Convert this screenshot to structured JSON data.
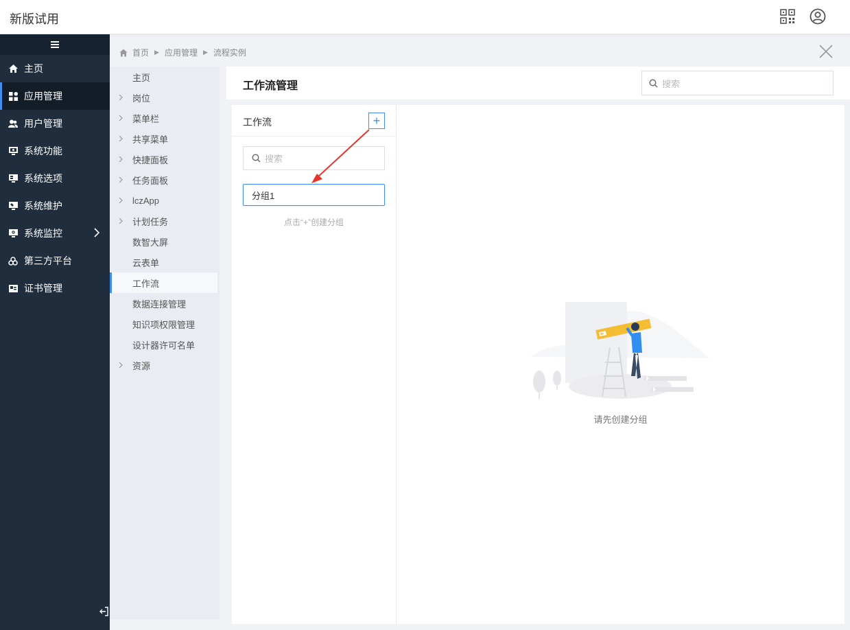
{
  "header": {
    "title": "新版试用",
    "icons": [
      "qr-code-icon",
      "user-circle-icon"
    ]
  },
  "sidenav": {
    "items": [
      {
        "label": "主页",
        "icon": "home-icon"
      },
      {
        "label": "应用管理",
        "icon": "apps-icon",
        "active": true
      },
      {
        "label": "用户管理",
        "icon": "users-icon"
      },
      {
        "label": "系统功能",
        "icon": "system-function-icon"
      },
      {
        "label": "系统选项",
        "icon": "system-options-icon"
      },
      {
        "label": "系统维护",
        "icon": "maintenance-icon"
      },
      {
        "label": "系统监控",
        "icon": "monitor-icon",
        "has_children": true
      },
      {
        "label": "第三方平台",
        "icon": "third-party-icon"
      },
      {
        "label": "证书管理",
        "icon": "certificate-icon"
      }
    ]
  },
  "submenu": {
    "items": [
      {
        "label": "主页",
        "expandable": false
      },
      {
        "label": "岗位",
        "expandable": true
      },
      {
        "label": "菜单栏",
        "expandable": true
      },
      {
        "label": "共享菜单",
        "expandable": true
      },
      {
        "label": "快捷面板",
        "expandable": true
      },
      {
        "label": "任务面板",
        "expandable": true
      },
      {
        "label": "lczApp",
        "expandable": true
      },
      {
        "label": "计划任务",
        "expandable": true
      },
      {
        "label": "数智大屏",
        "expandable": false
      },
      {
        "label": "云表单",
        "expandable": false
      },
      {
        "label": "工作流",
        "expandable": false,
        "active": true
      },
      {
        "label": "数据连接管理",
        "expandable": false
      },
      {
        "label": "知识项权限管理",
        "expandable": false
      },
      {
        "label": "设计器许可名单",
        "expandable": false
      },
      {
        "label": "资源",
        "expandable": true
      }
    ]
  },
  "breadcrumb": {
    "items": [
      "首页",
      "应用管理",
      "流程实例"
    ]
  },
  "main": {
    "title": "工作流管理",
    "search_placeholder": "搜索",
    "workflow": {
      "title": "工作流",
      "add_label": "+",
      "search_placeholder": "搜索",
      "group_value": "分组1",
      "hint": "点击“+”创建分组"
    },
    "empty_text": "请先创建分组"
  },
  "colors": {
    "accent": "#3d8ef0",
    "nav_bg": "#1f2d3d",
    "annotation": "#e8342a"
  }
}
